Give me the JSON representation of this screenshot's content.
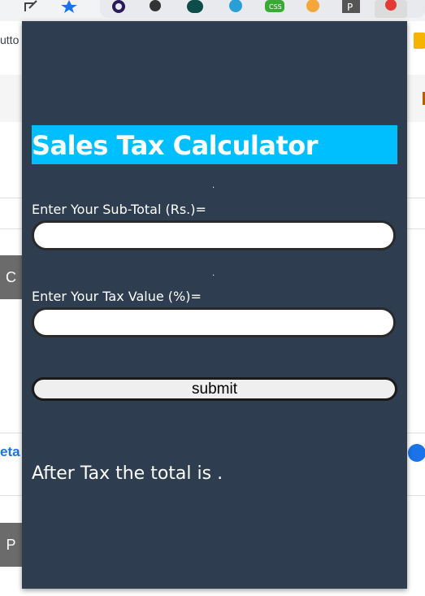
{
  "browser": {
    "bookmark_text": "utto",
    "extension_icon_letter": "P",
    "icons": [
      "edit-icon",
      "star-icon",
      "pie-icon",
      "github-icon",
      "binary-icon",
      "code-icon",
      "css-icon",
      "cat-icon",
      "p-icon",
      "sale-icon"
    ]
  },
  "background": {
    "tile_top": "C",
    "tile_bottom": "P",
    "link_text": "eta"
  },
  "calculator": {
    "title": "Sales Tax Calculator",
    "subtotal_label": "Enter Your Sub-Total (Rs.)=",
    "subtotal_value": "",
    "tax_label": "Enter Your Tax Value (%)=",
    "tax_value": "",
    "submit_label": "submit",
    "result_text": "After Tax the total is ."
  },
  "colors": {
    "popup_bg": "#2e3e50",
    "title_bg": "#00bfff",
    "accent_blue": "#1a73e8"
  }
}
